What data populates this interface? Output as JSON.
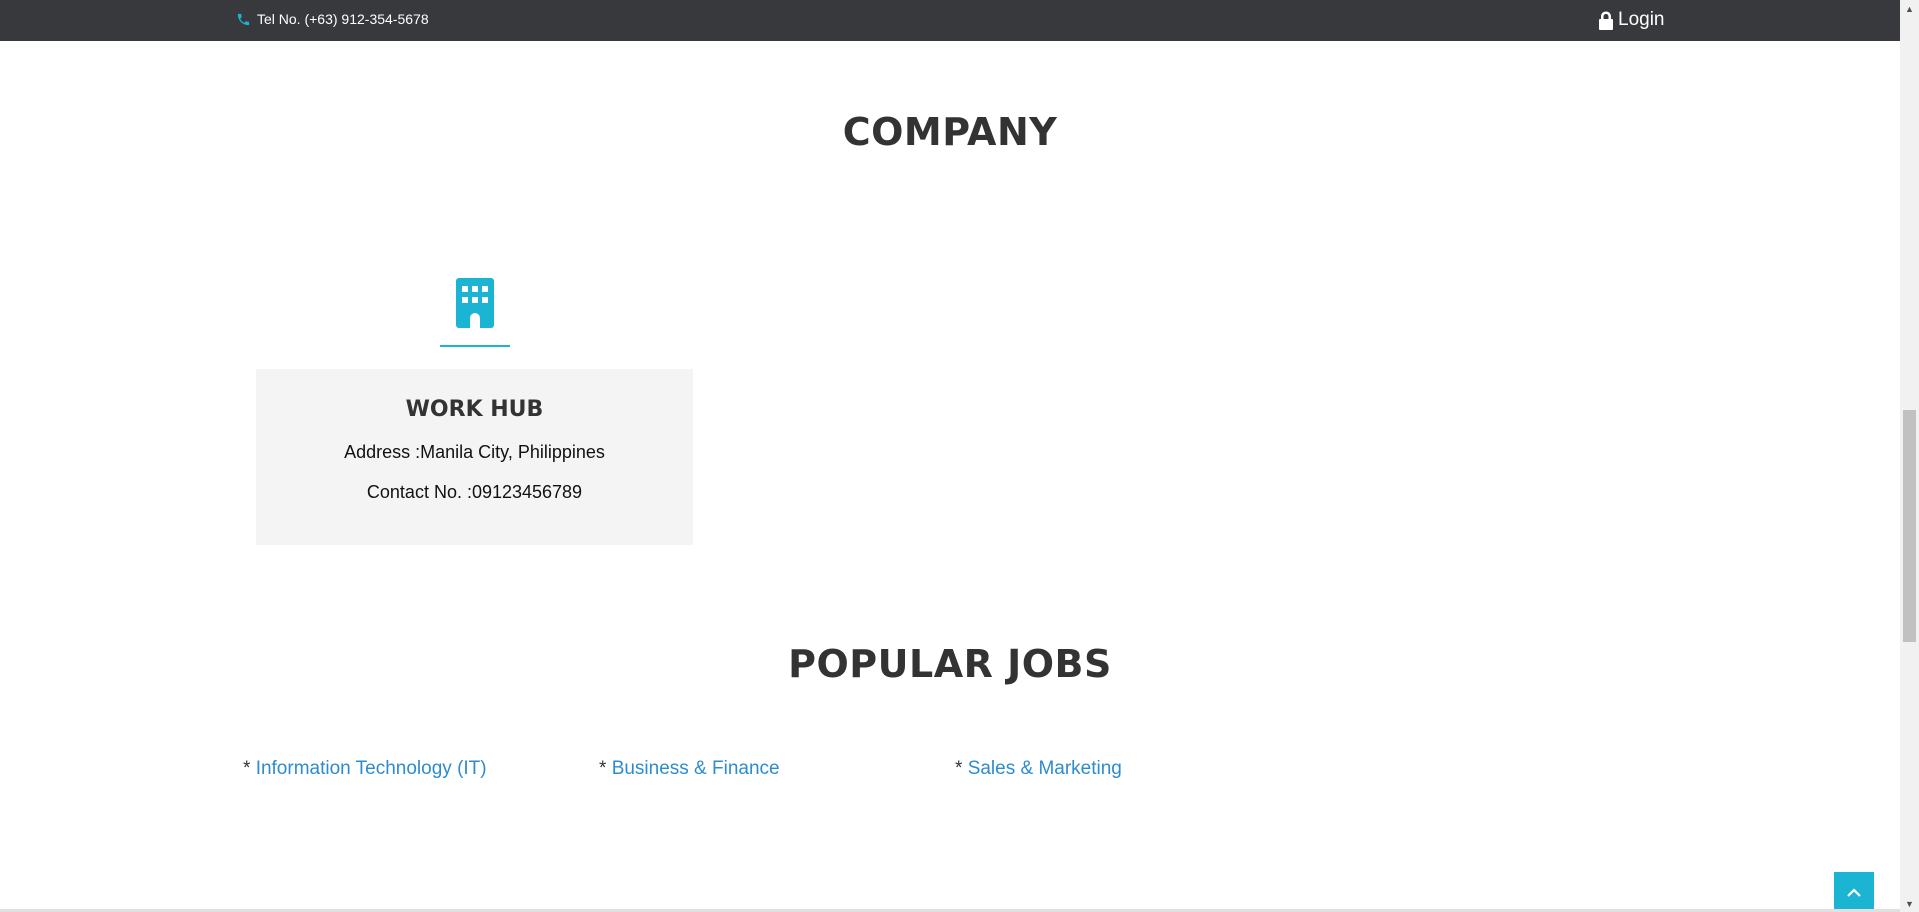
{
  "topbar": {
    "tel_text": "Tel No. (+63) 912-354-5678",
    "phone_icon": "phone-icon",
    "login_label": "Login",
    "login_icon": "lock-icon"
  },
  "company_section": {
    "title": "COMPANY",
    "icon": "building-icon",
    "card": {
      "name": "WORK HUB",
      "address": "Address :Manila City, Philippines",
      "contact": "Contact No. :09123456789"
    }
  },
  "jobs_section": {
    "title": "POPULAR JOBS",
    "items": [
      {
        "prefix": "* ",
        "label": "Information Technology (IT)"
      },
      {
        "prefix": "* ",
        "label": "Business & Finance"
      },
      {
        "prefix": "* ",
        "label": "Sales & Marketing"
      }
    ]
  },
  "back_to_top_icon": "chevron-up-icon",
  "colors": {
    "accent": "#1bb4d3",
    "topbar_bg": "#37393c",
    "link": "#2d8ccf",
    "card_bg": "#f4f4f4",
    "heading": "#333333"
  }
}
